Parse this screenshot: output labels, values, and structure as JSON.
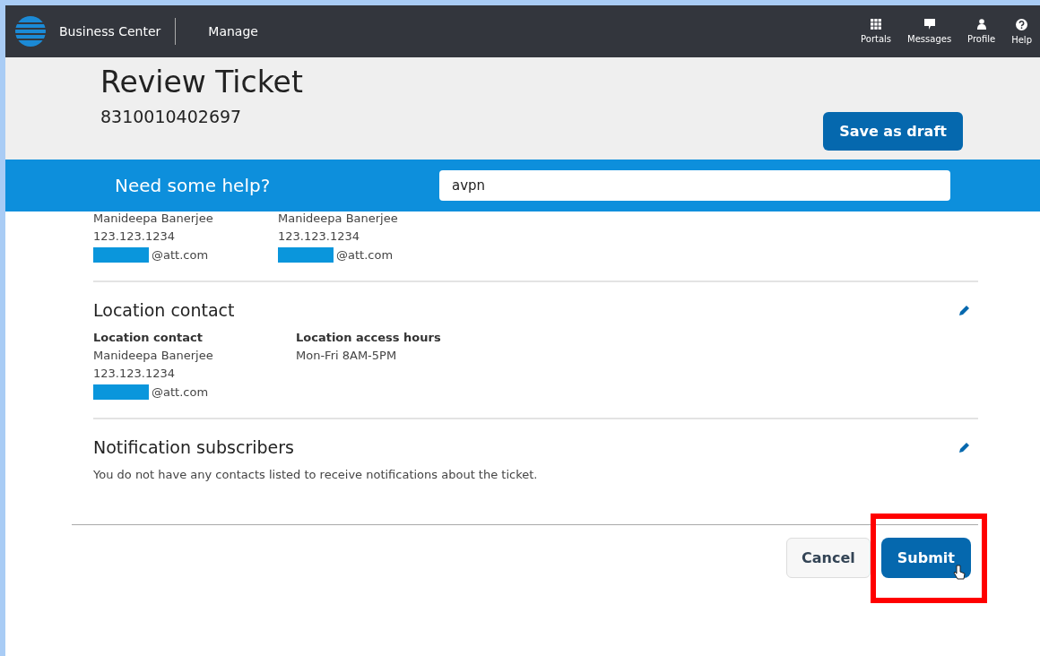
{
  "nav": {
    "brand": "Business Center",
    "link": "Manage",
    "actions": [
      {
        "kind": "portals",
        "label": "Portals"
      },
      {
        "kind": "messages",
        "label": "Messages"
      },
      {
        "kind": "profile",
        "label": "Profile"
      },
      {
        "kind": "help",
        "label": "Help"
      }
    ]
  },
  "header": {
    "title": "Review Ticket",
    "ticket_number": "8310010402697",
    "draft_button": "Save as draft"
  },
  "help_bar": {
    "label": "Need some help?",
    "search_value": "avpn"
  },
  "top_contacts": [
    {
      "name": "Manideepa Banerjee",
      "phone": "123.123.1234",
      "email": "@att.com"
    },
    {
      "name": "Manideepa Banerjee",
      "phone": "123.123.1234",
      "email": "@att.com"
    }
  ],
  "sections": [
    {
      "title": "Location contact",
      "editable": true,
      "columns": [
        {
          "heading": "Location contact",
          "lines": [
            "Manideepa Banerjee",
            "123.123.1234"
          ],
          "email": "@att.com"
        },
        {
          "heading": "Location access hours",
          "lines": [
            "Mon-Fri 8AM-5PM"
          ]
        }
      ]
    },
    {
      "title": "Notification subscribers",
      "editable": true,
      "note": "You do not have any contacts listed to receive notifications about the ticket."
    }
  ],
  "footer": {
    "cancel": "Cancel",
    "submit": "Submit",
    "submit_highlighted": true
  }
}
